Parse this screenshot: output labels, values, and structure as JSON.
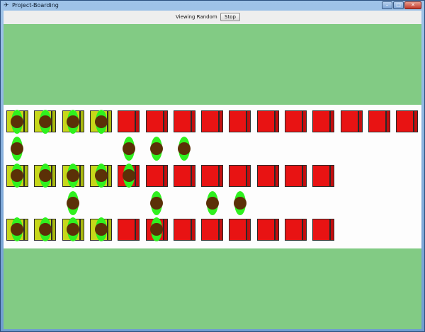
{
  "window": {
    "title": "Project-Boarding",
    "icon": "airplane-icon",
    "controls": [
      "minimize",
      "maximize",
      "close"
    ]
  },
  "toolbar": {
    "status_label": "Viewing Random",
    "stop_label": "Stop"
  },
  "colors": {
    "grass": "#82cb84",
    "aisle": "#fdfdfd",
    "seat_empty": "#e81313",
    "seat_taken": "#c7d71a",
    "passenger_body": "#2ff11f",
    "passenger_head": "#5b3007"
  },
  "rows": [
    {
      "occupied": 4,
      "seats": 15
    },
    {
      "occupied": 4,
      "seats": 12
    },
    {
      "occupied": 4,
      "seats": 12
    }
  ],
  "passengers": {
    "seated": 12,
    "walking": 10
  }
}
